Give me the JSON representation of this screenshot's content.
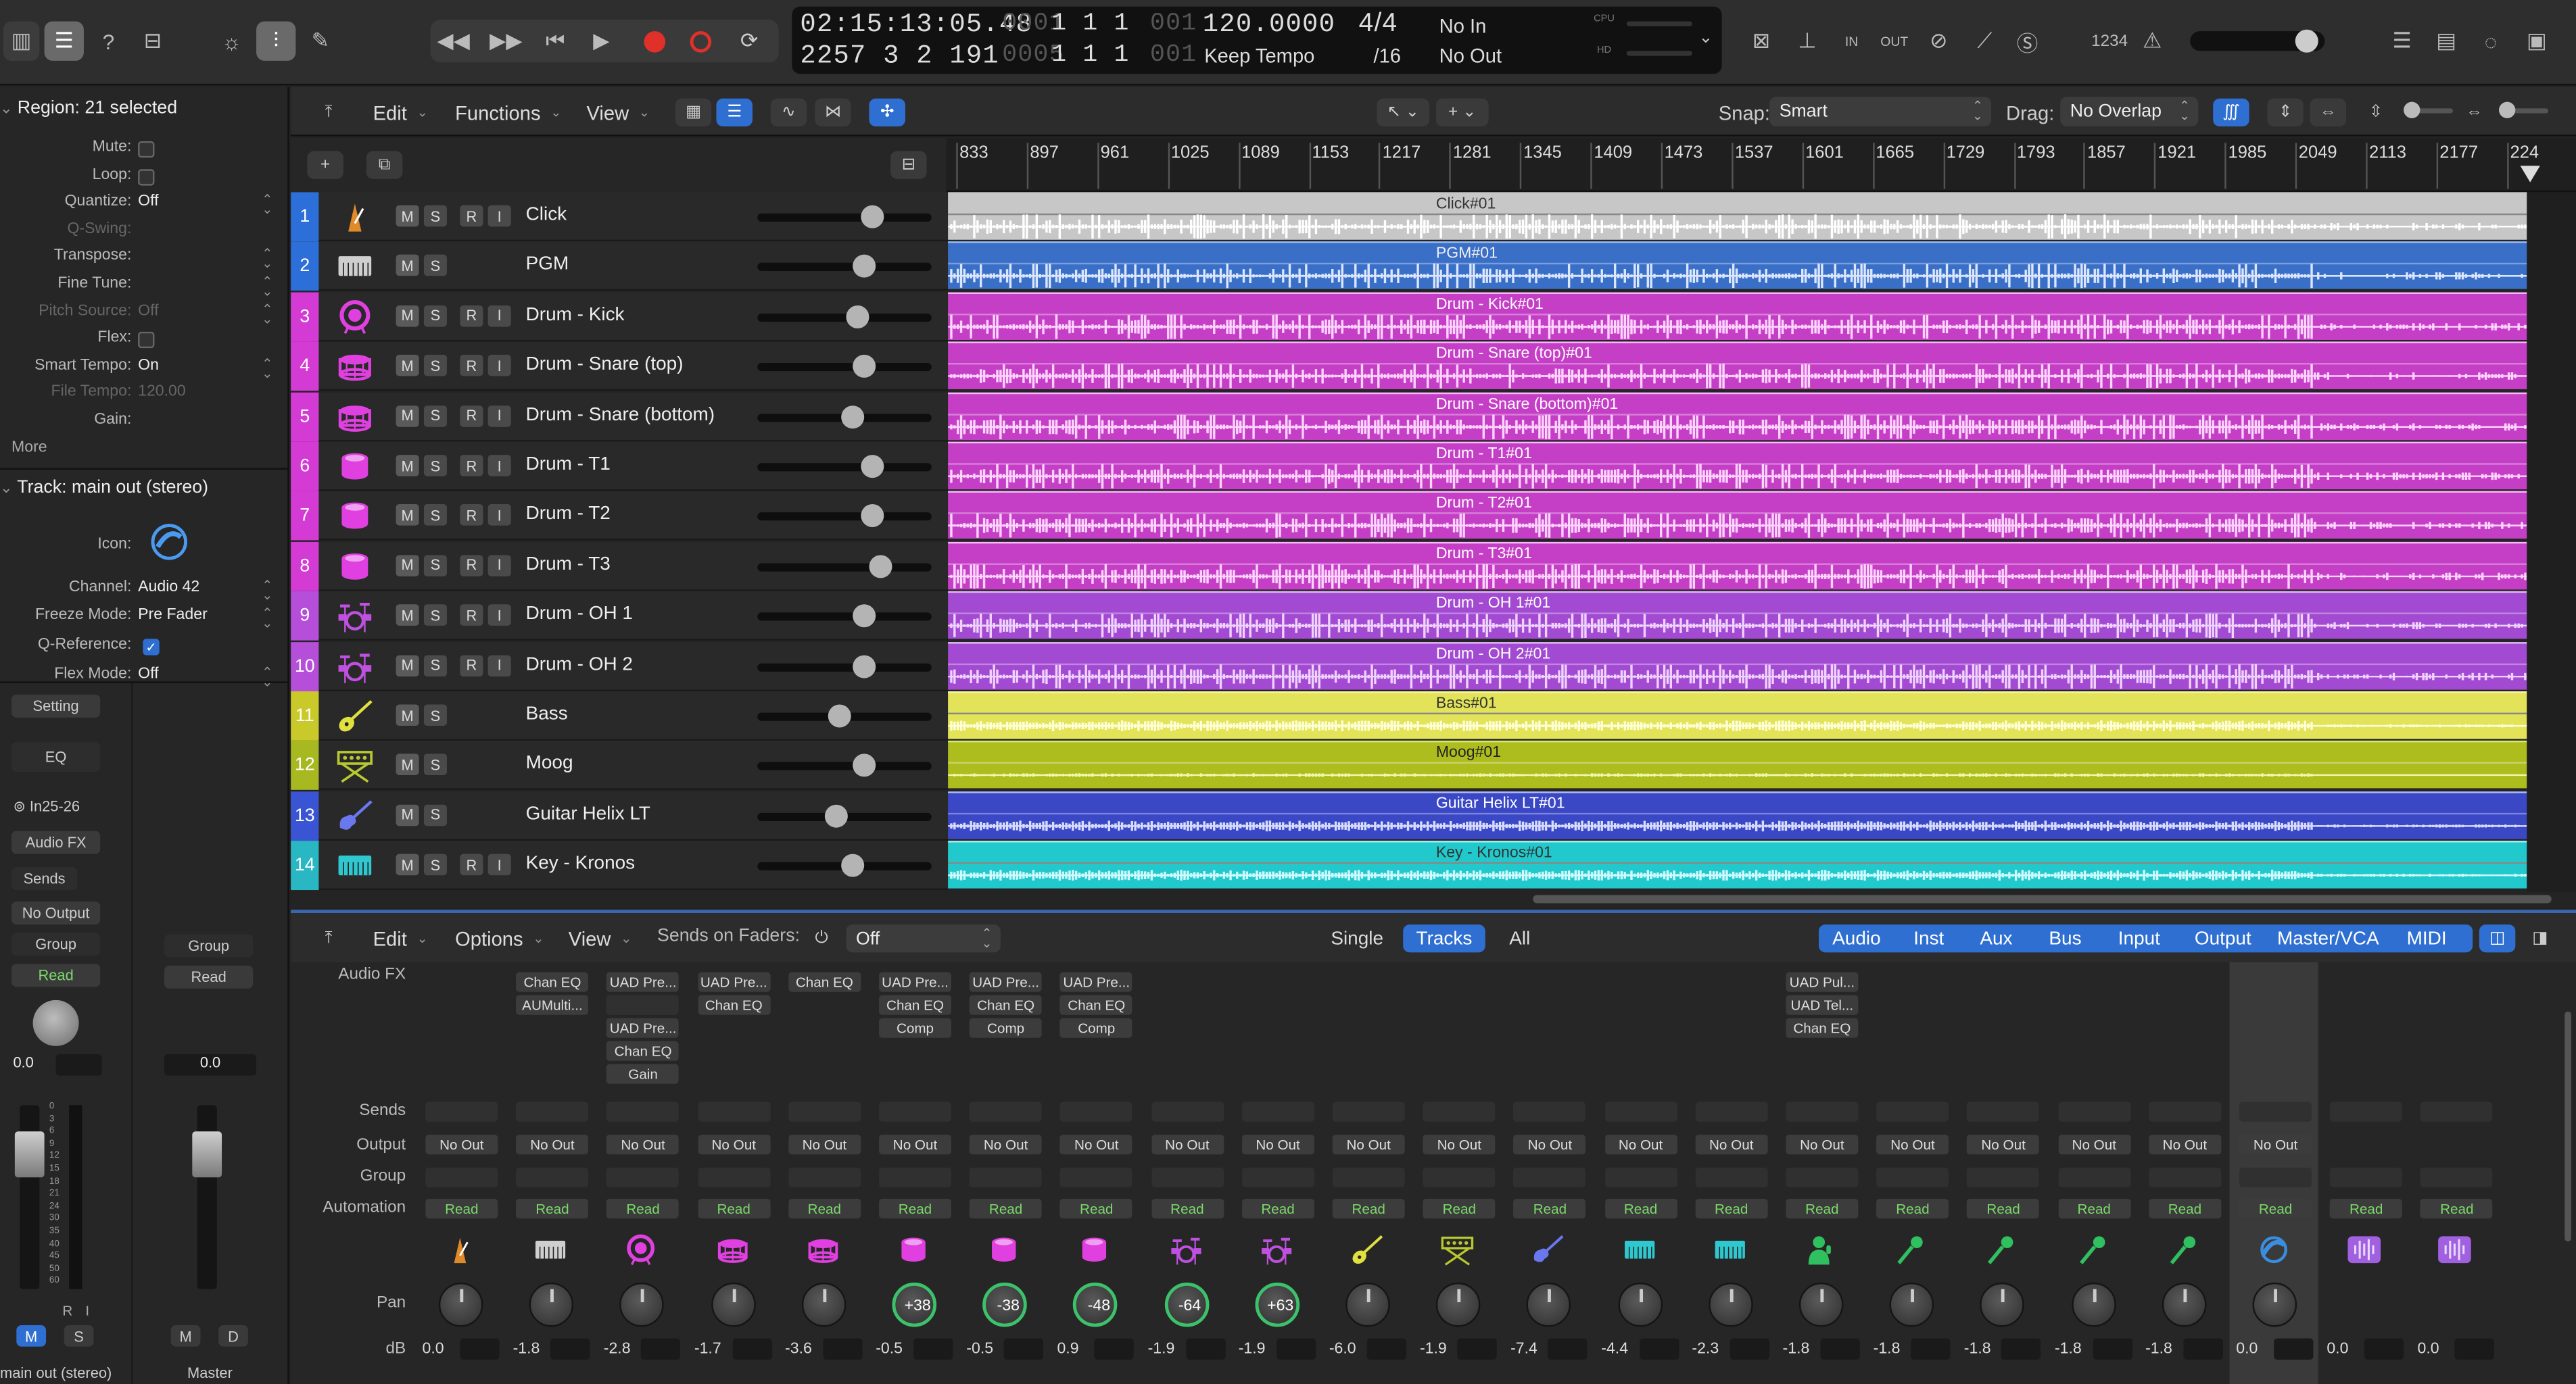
{
  "transport": {
    "position": "02:15:13:05.48",
    "bars": "2257  3  2  191",
    "sub1_dim": "0001",
    "sub1": "1  1  1",
    "sub1_dim2": "001",
    "sub2_dim": "0005",
    "sub2": "1  1  1",
    "sub2_dim2": "001",
    "tempo": "120.0000",
    "tempo_mode": "Keep Tempo",
    "signature": "4/4",
    "division": "/16",
    "in": "No In",
    "out": "No Out",
    "cpu": "CPU",
    "hd": "HD",
    "count_in": "1234"
  },
  "inspector": {
    "region_title": "Region: 21 selected",
    "region_rows": [
      {
        "label": "Mute:",
        "value": "",
        "type": "check"
      },
      {
        "label": "Loop:",
        "value": "",
        "type": "check"
      },
      {
        "label": "Quantize:",
        "value": "Off",
        "type": "select"
      },
      {
        "label": "Q-Swing:",
        "value": "",
        "type": "dim"
      },
      {
        "label": "Transpose:",
        "value": "",
        "type": "select"
      },
      {
        "label": "Fine Tune:",
        "value": "",
        "type": "select"
      },
      {
        "label": "Pitch Source:",
        "value": "Off",
        "type": "dimselect"
      },
      {
        "label": "Flex:",
        "value": "",
        "type": "check"
      },
      {
        "label": "Smart Tempo:",
        "value": "On",
        "type": "select"
      },
      {
        "label": "File Tempo:",
        "value": "120.00",
        "type": "dimval"
      },
      {
        "label": "Gain:",
        "value": "",
        "type": "plain"
      }
    ],
    "more": "More",
    "track_title_prefix": "Track:",
    "track_title": "main out (stereo)",
    "track_rows": [
      {
        "label": "Icon:",
        "value": ""
      },
      {
        "label": "Channel:",
        "value": "Audio 42"
      },
      {
        "label": "Freeze Mode:",
        "value": "Pre Fader"
      },
      {
        "label": "Q-Reference:",
        "value": "✓"
      },
      {
        "label": "Flex Mode:",
        "value": "Off"
      }
    ],
    "strip1": {
      "setting": "Setting",
      "eq": "EQ",
      "input": "In25-26",
      "audio_fx": "Audio FX",
      "sends": "Sends",
      "output": "No Output",
      "group": "Group",
      "read": "Read",
      "vol": "0.0",
      "m": "M",
      "s": "S",
      "r": "R",
      "i": "I",
      "name": "main out (stereo)"
    },
    "strip2": {
      "group": "Group",
      "read": "Read",
      "vol": "0.0",
      "m": "M",
      "d": "D",
      "name": "Master"
    },
    "fader_scale": [
      "0",
      "3",
      "6",
      "9",
      "12",
      "15",
      "18",
      "21",
      "24",
      "30",
      "35",
      "40",
      "45",
      "50",
      "60"
    ]
  },
  "toolbar": {
    "edit": "Edit",
    "functions": "Functions",
    "view": "View",
    "snap_label": "Snap:",
    "snap_value": "Smart",
    "drag_label": "Drag:",
    "drag_value": "No Overlap"
  },
  "ruler": [
    "833",
    "897",
    "961",
    "1025",
    "1089",
    "1153",
    "1217",
    "1281",
    "1345",
    "1409",
    "1473",
    "1537",
    "1601",
    "1665",
    "1729",
    "1793",
    "1857",
    "1921",
    "1985",
    "2049",
    "2113",
    "2177",
    "224"
  ],
  "tracks": [
    {
      "num": "1",
      "name": "Click",
      "color": "#2c6fd9",
      "region": "Click#01",
      "rcolor": "#c7c7c7",
      "rtext": "#333",
      "wave": "#ffffff",
      "fader": 0.69,
      "rec": true,
      "icon": "metronome-icon"
    },
    {
      "num": "2",
      "name": "PGM",
      "color": "#2c6fd9",
      "region": "PGM#01",
      "rcolor": "#3a6fc8",
      "rtext": "#eee",
      "wave": "#dbe6ff",
      "fader": 0.63,
      "rec": false,
      "icon": "keyboard-icon",
      "hi": "#9bbcf0"
    },
    {
      "num": "3",
      "name": "Drum - Kick",
      "color": "#d43ad4",
      "region": "Drum - Kick#01",
      "rcolor": "#c43fc6",
      "rtext": "#fff",
      "wave": "#ffd5ff",
      "fader": 0.59,
      "rec": true,
      "icon": "kick-drum-icon",
      "hi": "#f8b8fa"
    },
    {
      "num": "4",
      "name": "Drum - Snare (top)",
      "color": "#d43ad4",
      "region": "Drum - Snare (top)#01",
      "rcolor": "#c43fc6",
      "rtext": "#fff",
      "wave": "#ffd5ff",
      "fader": 0.63,
      "rec": true,
      "icon": "snare-drum-icon",
      "hi": "#f8b8fa"
    },
    {
      "num": "5",
      "name": "Drum - Snare (bottom)",
      "color": "#d43ad4",
      "region": "Drum - Snare (bottom)#01",
      "rcolor": "#c43fc6",
      "rtext": "#fff",
      "wave": "#ffd5ff",
      "fader": 0.55,
      "rec": true,
      "icon": "snare-drum-icon",
      "hi": "#f8b8fa"
    },
    {
      "num": "6",
      "name": "Drum - T1",
      "color": "#d43ad4",
      "region": "Drum - T1#01",
      "rcolor": "#c43fc6",
      "rtext": "#fff",
      "wave": "#ffd5ff",
      "fader": 0.68,
      "rec": true,
      "icon": "tom-drum-icon",
      "hi": "#f8b8fa"
    },
    {
      "num": "7",
      "name": "Drum - T2",
      "color": "#d43ad4",
      "region": "Drum - T2#01",
      "rcolor": "#c43fc6",
      "rtext": "#fff",
      "wave": "#ffd5ff",
      "fader": 0.68,
      "rec": true,
      "icon": "tom-drum-icon",
      "hi": "#f8b8fa"
    },
    {
      "num": "8",
      "name": "Drum - T3",
      "color": "#d43ad4",
      "region": "Drum - T3#01",
      "rcolor": "#c43fc6",
      "rtext": "#fff",
      "wave": "#ffd5ff",
      "fader": 0.74,
      "rec": true,
      "icon": "tom-drum-icon",
      "hi": "#f8b8fa"
    },
    {
      "num": "9",
      "name": "Drum - OH 1",
      "color": "#b54ed9",
      "region": "Drum - OH 1#01",
      "rcolor": "#a24ad2",
      "rtext": "#fff",
      "wave": "#f0d2ff",
      "fader": 0.63,
      "rec": true,
      "icon": "drum-kit-icon",
      "hi": "#e0b8f6"
    },
    {
      "num": "10",
      "name": "Drum - OH 2",
      "color": "#b54ed9",
      "region": "Drum - OH 2#01",
      "rcolor": "#a24ad2",
      "rtext": "#fff",
      "wave": "#f0d2ff",
      "fader": 0.63,
      "rec": true,
      "icon": "drum-kit-icon",
      "hi": "#e0b8f6"
    },
    {
      "num": "11",
      "name": "Bass",
      "color": "#c9c92a",
      "region": "Bass#01",
      "rcolor": "#e3e35a",
      "rtext": "#333",
      "wave": "#ffffd8",
      "fader": 0.47,
      "rec": false,
      "icon": "bass-guitar-icon",
      "hi": "#f7f7a8"
    },
    {
      "num": "12",
      "name": "Moog",
      "color": "#a8b820",
      "region": "Moog#01",
      "rcolor": "#aebd1e",
      "rtext": "#222",
      "wave": "#f0f8b0",
      "fader": 0.63,
      "rec": false,
      "icon": "synth-icon",
      "hi": "#dbe878"
    },
    {
      "num": "13",
      "name": "Guitar Helix LT",
      "color": "#3a55d4",
      "region": "Guitar Helix LT#01",
      "rcolor": "#3a48c6",
      "rtext": "#fff",
      "wave": "#d8dcff",
      "fader": 0.45,
      "rec": false,
      "icon": "guitar-icon",
      "hi": "#b4bcf4"
    },
    {
      "num": "14",
      "name": "Key - Kronos",
      "color": "#2ab7c4",
      "region": "Key - Kronos#01",
      "rcolor": "#22c9cc",
      "rtext": "#333",
      "wave": "#cffaff",
      "fader": 0.55,
      "rec": true,
      "icon": "keyboard-icon",
      "hi": "#a8f0f2"
    }
  ],
  "mixer": {
    "edit": "Edit",
    "options": "Options",
    "view": "View",
    "sends_label": "Sends on Faders:",
    "sends_value": "Off",
    "tabs": [
      "Single",
      "Tracks",
      "All"
    ],
    "active_tab": "Tracks",
    "filters": [
      "Audio",
      "Inst",
      "Aux",
      "Bus",
      "Input",
      "Output",
      "Master/VCA",
      "MIDI"
    ],
    "row_labels": {
      "audio_fx": "Audio FX",
      "sends": "Sends",
      "output": "Output",
      "group": "Group",
      "automation": "Automation",
      "pan": "Pan",
      "db": "dB"
    },
    "strips": [
      {
        "plugins": [],
        "out": "No Out",
        "read": "Read",
        "pan": "",
        "pan_on": false,
        "db": "0.0",
        "icon": "metronome-icon",
        "ic": "#e08a2a"
      },
      {
        "plugins": [
          "Chan EQ",
          "AUMulti..."
        ],
        "out": "No Out",
        "read": "Read",
        "pan": "",
        "pan_on": false,
        "db": "-1.8",
        "icon": "keyboard-icon",
        "ic": "#cfcfcf"
      },
      {
        "plugins": [
          "UAD Pre...",
          "",
          "UAD Pre...",
          "Chan EQ",
          "Gain"
        ],
        "out": "No Out",
        "read": "Read",
        "pan": "",
        "pan_on": false,
        "db": "-2.8",
        "icon": "kick-drum-icon",
        "ic": "#e040e0"
      },
      {
        "plugins": [
          "UAD Pre...",
          "Chan EQ"
        ],
        "out": "No Out",
        "read": "Read",
        "pan": "",
        "pan_on": false,
        "db": "-1.7",
        "icon": "snare-drum-icon",
        "ic": "#e040e0"
      },
      {
        "plugins": [
          "Chan EQ"
        ],
        "out": "No Out",
        "read": "Read",
        "pan": "",
        "pan_on": false,
        "db": "-3.6",
        "icon": "snare-drum-icon",
        "ic": "#e040e0"
      },
      {
        "plugins": [
          "UAD Pre...",
          "Chan EQ",
          "Comp"
        ],
        "out": "No Out",
        "read": "Read",
        "pan": "+38",
        "pan_on": true,
        "db": "-0.5",
        "icon": "tom-drum-icon",
        "ic": "#e040e0"
      },
      {
        "plugins": [
          "UAD Pre...",
          "Chan EQ",
          "Comp"
        ],
        "out": "No Out",
        "read": "Read",
        "pan": "-38",
        "pan_on": true,
        "db": "-0.5",
        "icon": "tom-drum-icon",
        "ic": "#e040e0"
      },
      {
        "plugins": [
          "UAD Pre...",
          "Chan EQ",
          "Comp"
        ],
        "out": "No Out",
        "read": "Read",
        "pan": "-48",
        "pan_on": true,
        "db": "0.9",
        "icon": "tom-drum-icon",
        "ic": "#e040e0"
      },
      {
        "plugins": [],
        "out": "No Out",
        "read": "Read",
        "pan": "-64",
        "pan_on": true,
        "db": "-1.9",
        "icon": "drum-kit-icon",
        "ic": "#c050e0"
      },
      {
        "plugins": [],
        "out": "No Out",
        "read": "Read",
        "pan": "+63",
        "pan_on": true,
        "db": "-1.9",
        "icon": "drum-kit-icon",
        "ic": "#c050e0"
      },
      {
        "plugins": [],
        "out": "No Out",
        "read": "Read",
        "pan": "",
        "pan_on": false,
        "db": "-6.0",
        "icon": "bass-guitar-icon",
        "ic": "#e0e040"
      },
      {
        "plugins": [],
        "out": "No Out",
        "read": "Read",
        "pan": "",
        "pan_on": false,
        "db": "-1.9",
        "icon": "synth-icon",
        "ic": "#b8c830"
      },
      {
        "plugins": [],
        "out": "No Out",
        "read": "Read",
        "pan": "",
        "pan_on": false,
        "db": "-7.4",
        "icon": "guitar-icon",
        "ic": "#6a78f0"
      },
      {
        "plugins": [],
        "out": "No Out",
        "read": "Read",
        "pan": "",
        "pan_on": false,
        "db": "-4.4",
        "icon": "keyboard-icon",
        "ic": "#30c8d0"
      },
      {
        "plugins": [],
        "out": "No Out",
        "read": "Read",
        "pan": "",
        "pan_on": false,
        "db": "-2.3",
        "icon": "keyboard-icon",
        "ic": "#30c8d0"
      },
      {
        "plugins": [
          "UAD Pul...",
          "UAD Tel...",
          "Chan EQ"
        ],
        "out": "No Out",
        "read": "Read",
        "pan": "",
        "pan_on": false,
        "db": "-1.8",
        "icon": "vocalist-icon",
        "ic": "#30c060"
      },
      {
        "plugins": [],
        "out": "No Out",
        "read": "Read",
        "pan": "",
        "pan_on": false,
        "db": "-1.8",
        "icon": "microphone-icon",
        "ic": "#30c060"
      },
      {
        "plugins": [],
        "out": "No Out",
        "read": "Read",
        "pan": "",
        "pan_on": false,
        "db": "-1.8",
        "icon": "microphone-icon",
        "ic": "#30c060"
      },
      {
        "plugins": [],
        "out": "No Out",
        "read": "Read",
        "pan": "",
        "pan_on": false,
        "db": "-1.8",
        "icon": "microphone-icon",
        "ic": "#30c060"
      },
      {
        "plugins": [],
        "out": "No Out",
        "read": "Read",
        "pan": "",
        "pan_on": false,
        "db": "-1.8",
        "icon": "microphone-icon",
        "ic": "#30c060"
      },
      {
        "plugins": [],
        "out": "No Out",
        "read": "Read",
        "pan": "",
        "pan_on": false,
        "db": "0.0",
        "icon": "speaker-icon",
        "ic": "#3a8ee0",
        "selected": true
      },
      {
        "plugins": [],
        "out": "",
        "read": "Read",
        "pan": "",
        "pan_on": false,
        "db": "0.0",
        "icon": "waveform-icon",
        "ic": "#a060e0",
        "noknob": true
      },
      {
        "plugins": [],
        "out": "",
        "read": "Read",
        "pan": "",
        "pan_on": false,
        "db": "0.0",
        "icon": "waveform-icon",
        "ic": "#a060e0",
        "noknob": true
      }
    ]
  },
  "colors": {
    "accent": "#2f6fd1",
    "record": "#e0302a",
    "read_green": "#7bd96b"
  }
}
